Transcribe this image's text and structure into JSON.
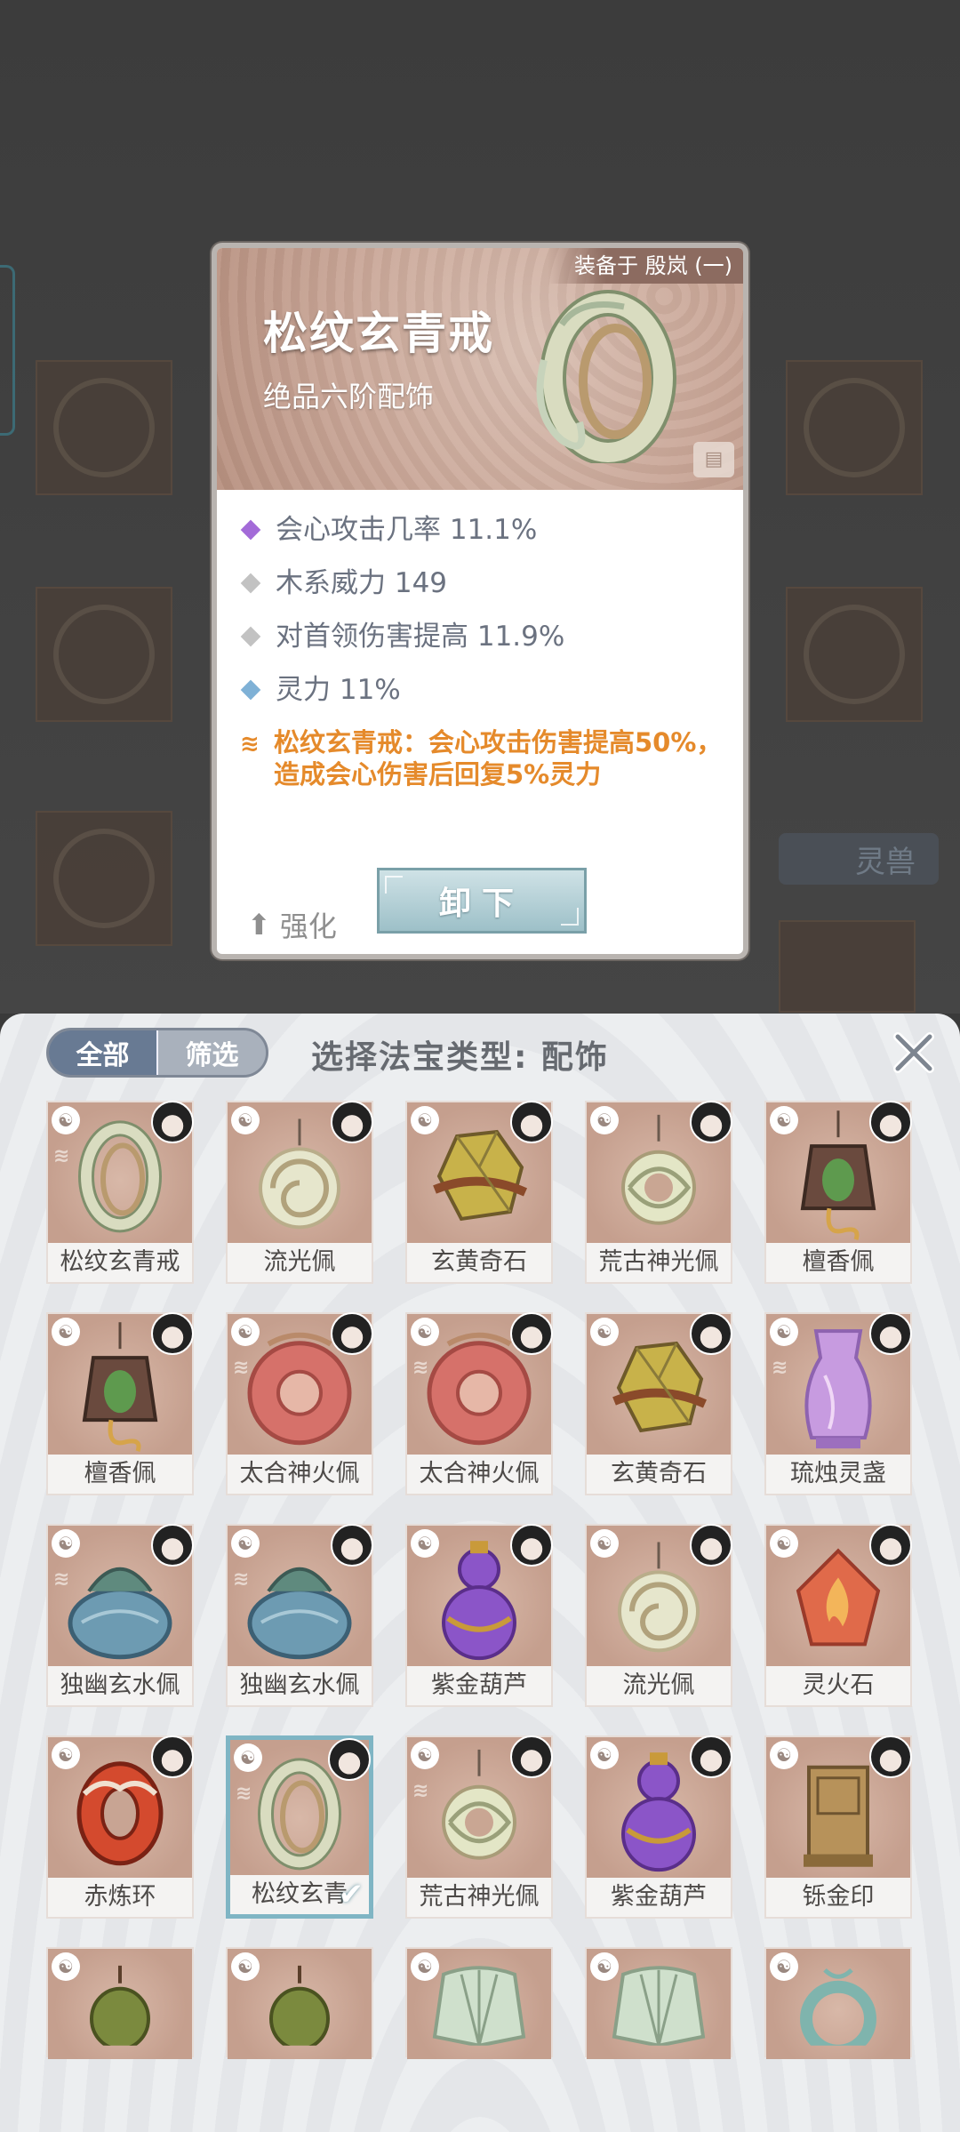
{
  "detail": {
    "equipped_by": "装备于 殷岚 (一)",
    "title": "松纹玄青戒",
    "grade": "绝品六阶配饰",
    "attributes": [
      {
        "text": "会心攻击几率 11.1%",
        "color": "#a36bd8"
      },
      {
        "text": "木系威力 149",
        "color": "#c2c2c2"
      },
      {
        "text": "对首领伤害提高 11.9%",
        "color": "#c2c2c2"
      },
      {
        "text": "灵力 11%",
        "color": "#7fb1d6"
      }
    ],
    "special_text": "松纹玄青戒：会心攻击伤害提高50%，造成会心伤害后回复5%灵力",
    "enhance_label": "强化",
    "unequip_label": "卸下"
  },
  "background": {
    "pet_tab": "灵兽"
  },
  "panel": {
    "tabs": [
      {
        "label": "全部",
        "active": true
      },
      {
        "label": "筛选",
        "active": false
      }
    ],
    "type_label": "选择法宝类型: 配饰",
    "items": [
      {
        "name": "松纹玄青戒",
        "art": "ring",
        "tag": true
      },
      {
        "name": "流光佩",
        "art": "jade-disc",
        "tag": false
      },
      {
        "name": "玄黄奇石",
        "art": "stone",
        "tag": false
      },
      {
        "name": "荒古神光佩",
        "art": "pendant",
        "tag": false
      },
      {
        "name": "檀香佩",
        "art": "lantern",
        "tag": false
      },
      {
        "name": "檀香佩",
        "art": "lantern",
        "tag": false
      },
      {
        "name": "太合神火佩",
        "art": "red-disc",
        "tag": true
      },
      {
        "name": "太合神火佩",
        "art": "red-disc",
        "tag": true
      },
      {
        "name": "玄黄奇石",
        "art": "stone",
        "tag": false
      },
      {
        "name": "琉烛灵盏",
        "art": "purple-vase",
        "tag": true
      },
      {
        "name": "独幽玄水佩",
        "art": "blue-jar",
        "tag": true
      },
      {
        "name": "独幽玄水佩",
        "art": "blue-jar",
        "tag": true
      },
      {
        "name": "紫金葫芦",
        "art": "gourd",
        "tag": false
      },
      {
        "name": "流光佩",
        "art": "jade-disc",
        "tag": false
      },
      {
        "name": "灵火石",
        "art": "fire-stone",
        "tag": false
      },
      {
        "name": "赤炼环",
        "art": "red-ring",
        "tag": false
      },
      {
        "name": "松纹玄青",
        "art": "ring",
        "tag": true,
        "selected": true
      },
      {
        "name": "荒古神光佩",
        "art": "pendant",
        "tag": true
      },
      {
        "name": "紫金葫芦",
        "art": "gourd",
        "tag": false
      },
      {
        "name": "铄金印",
        "art": "seal",
        "tag": false
      },
      {
        "name": "",
        "art": "green-gourd",
        "tag": false
      },
      {
        "name": "",
        "art": "green-gourd",
        "tag": false
      },
      {
        "name": "",
        "art": "fan",
        "tag": false
      },
      {
        "name": "",
        "art": "fan",
        "tag": false
      },
      {
        "name": "",
        "art": "jade-ring",
        "tag": false
      }
    ]
  }
}
